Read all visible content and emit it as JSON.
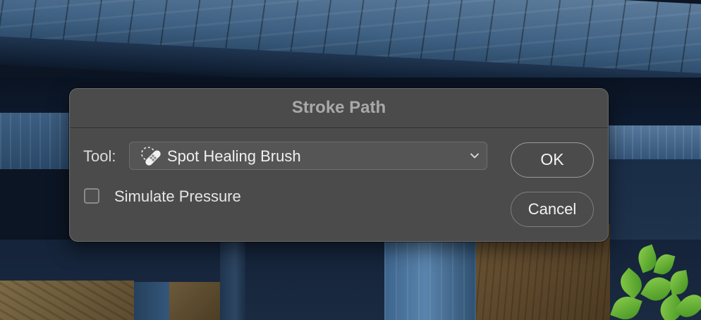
{
  "dialog": {
    "title": "Stroke Path",
    "tool": {
      "label": "Tool:",
      "selected": "Spot Healing Brush",
      "icon": "spot-healing-brush-icon"
    },
    "simulate_pressure": {
      "label": "Simulate Pressure",
      "checked": false
    },
    "buttons": {
      "ok": "OK",
      "cancel": "Cancel"
    }
  },
  "colors": {
    "dialog_bg": "#4b4b4b",
    "title_text": "#a9a9a9",
    "text": "#e6e6e6"
  }
}
